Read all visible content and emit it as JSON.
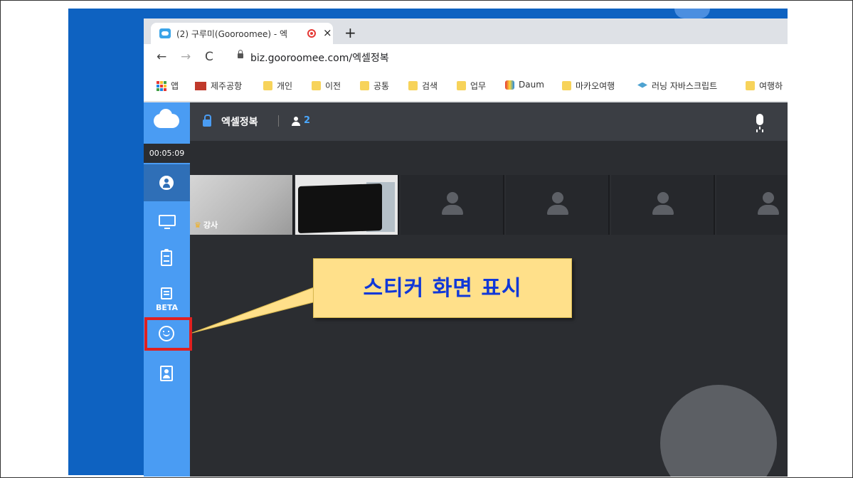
{
  "browser": {
    "tab_title": "(2) 구루미(Gooroomee) - 엑",
    "tab_close": "×",
    "new_tab": "+",
    "back": "←",
    "forward": "→",
    "reload": "C",
    "url": "biz.gooroomee.com/엑셀정복",
    "bookmarks": [
      {
        "label": "앱",
        "icon": "apps-icon"
      },
      {
        "label": "제주공항",
        "icon": "kac-logo-icon"
      },
      {
        "label": "개인",
        "icon": "folder-icon"
      },
      {
        "label": "이전",
        "icon": "folder-icon"
      },
      {
        "label": "공통",
        "icon": "folder-icon"
      },
      {
        "label": "검색",
        "icon": "folder-icon"
      },
      {
        "label": "업무",
        "icon": "folder-icon"
      },
      {
        "label": "Daum",
        "icon": "daum-icon"
      },
      {
        "label": "마카오여행",
        "icon": "folder-icon"
      },
      {
        "label": "러닝 자바스크립트",
        "icon": "graduation-cap-icon"
      },
      {
        "label": "여행하",
        "icon": "folder-icon"
      }
    ]
  },
  "app": {
    "timer": "00:05:09",
    "room_name": "엑셀정복",
    "participant_count": "2",
    "sidebar": {
      "items": [
        {
          "name": "participants",
          "icon": "user-circle-icon",
          "active": true
        },
        {
          "name": "screen-share",
          "icon": "monitor-icon"
        },
        {
          "name": "clipboard",
          "icon": "clipboard-icon"
        },
        {
          "name": "notes",
          "icon": "note-edit-icon",
          "badge": "BETA"
        },
        {
          "name": "sticker",
          "icon": "smile-icon"
        },
        {
          "name": "contacts",
          "icon": "contact-card-icon"
        }
      ]
    },
    "videos": [
      {
        "label": "강사",
        "host": true
      },
      {
        "label": ""
      },
      {
        "label": ""
      },
      {
        "label": ""
      },
      {
        "label": ""
      },
      {
        "label": ""
      }
    ]
  },
  "annotation": {
    "callout_text": "스티커 화면 표시",
    "highlight_color": "#e02020",
    "callout_color": "#ffe08a",
    "callout_text_color": "#1038d8"
  }
}
